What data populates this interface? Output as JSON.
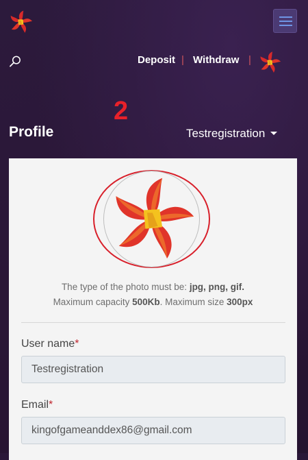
{
  "header": {
    "logo_icon": "star-logo-icon",
    "menu_icon": "hamburger-menu-icon"
  },
  "nav": {
    "search_icon": "search-icon",
    "deposit_label": "Deposit",
    "separator": "|",
    "withdraw_label": "Withdraw",
    "avatar_icon": "star-logo-icon"
  },
  "overlay": {
    "step_number": "2"
  },
  "profile": {
    "title": "Profile",
    "user_dropdown_label": "Testregistration",
    "photo_help": {
      "line1_prefix": "The type of the photo must be: ",
      "line1_formats": "jpg, png, gif.",
      "line2_prefix": "Maximum capacity ",
      "line2_capacity": "500Kb",
      "line2_mid": ". Maximum size ",
      "line2_size": "300px"
    },
    "fields": {
      "username_label": "User name",
      "username_value": "Testregistration",
      "email_label": "Email",
      "email_value": "kingofgameanddex86@gmail.com",
      "required_mark": "*"
    }
  },
  "colors": {
    "background": "#2a1738",
    "step_number": "#e8212a",
    "required": "#c0272f",
    "photo_circle": "#d81f2a",
    "separator": "#d0545d"
  }
}
